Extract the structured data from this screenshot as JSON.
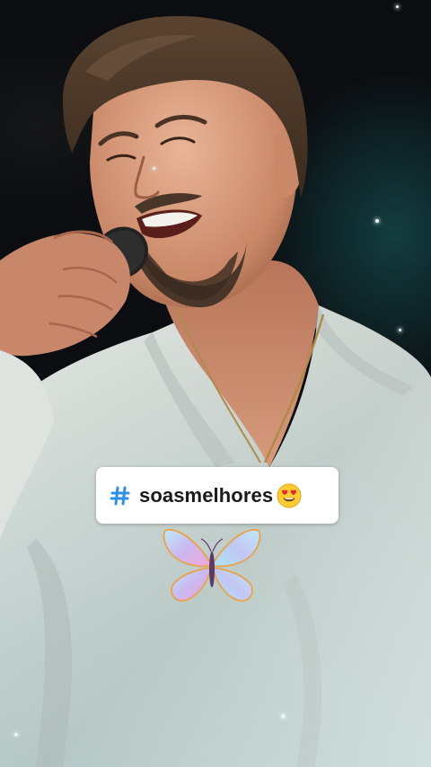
{
  "sticker": {
    "hashtag_text": "soasmelhores"
  },
  "icons": {
    "hashtag": "hashtag-icon",
    "emoji": "heart-eyes-emoji-icon",
    "butterfly": "butterfly-sticker-icon"
  },
  "colors": {
    "hashtag_blue": "#2e8fe6",
    "sticker_bg": "#ffffff",
    "background": "#0b0d10",
    "shirt": "#d9ddd8"
  }
}
